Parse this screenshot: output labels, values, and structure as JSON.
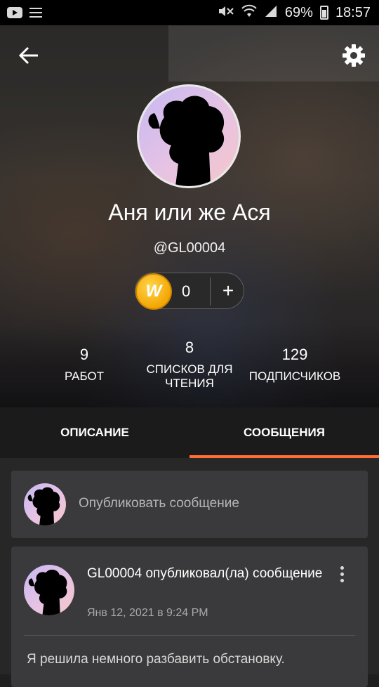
{
  "status_bar": {
    "battery_percent": "69%",
    "time": "18:57",
    "icons": [
      "youtube-icon",
      "list-icon",
      "mute-icon",
      "wifi-icon",
      "signal-icon",
      "battery-icon"
    ]
  },
  "profile": {
    "name": "Аня или же Ася",
    "handle": "@GL00004",
    "coins": "0",
    "add_label": "+",
    "coin_letter": "W",
    "stats": [
      {
        "value": "9",
        "label": "РАБОТ"
      },
      {
        "value": "8",
        "label": "СПИСКОВ ДЛЯ ЧТЕНИЯ"
      },
      {
        "value": "129",
        "label": "ПОДПИСЧИКОВ"
      }
    ]
  },
  "tabs": [
    {
      "label": "ОПИСАНИЕ",
      "active": false
    },
    {
      "label": "СООБЩЕНИЯ",
      "active": true
    }
  ],
  "compose": {
    "placeholder": "Опубликовать сообщение"
  },
  "post": {
    "author": "GL00004",
    "action": "опубликовал(ла) сообщение",
    "date": "Янв 12, 2021 в 9:24 PM",
    "body": "Я решила немного разбавить обстановку."
  },
  "colors": {
    "accent": "#ff6d30",
    "coin": "#f2a300",
    "card": "#3a3a3c",
    "background": "#272727"
  }
}
